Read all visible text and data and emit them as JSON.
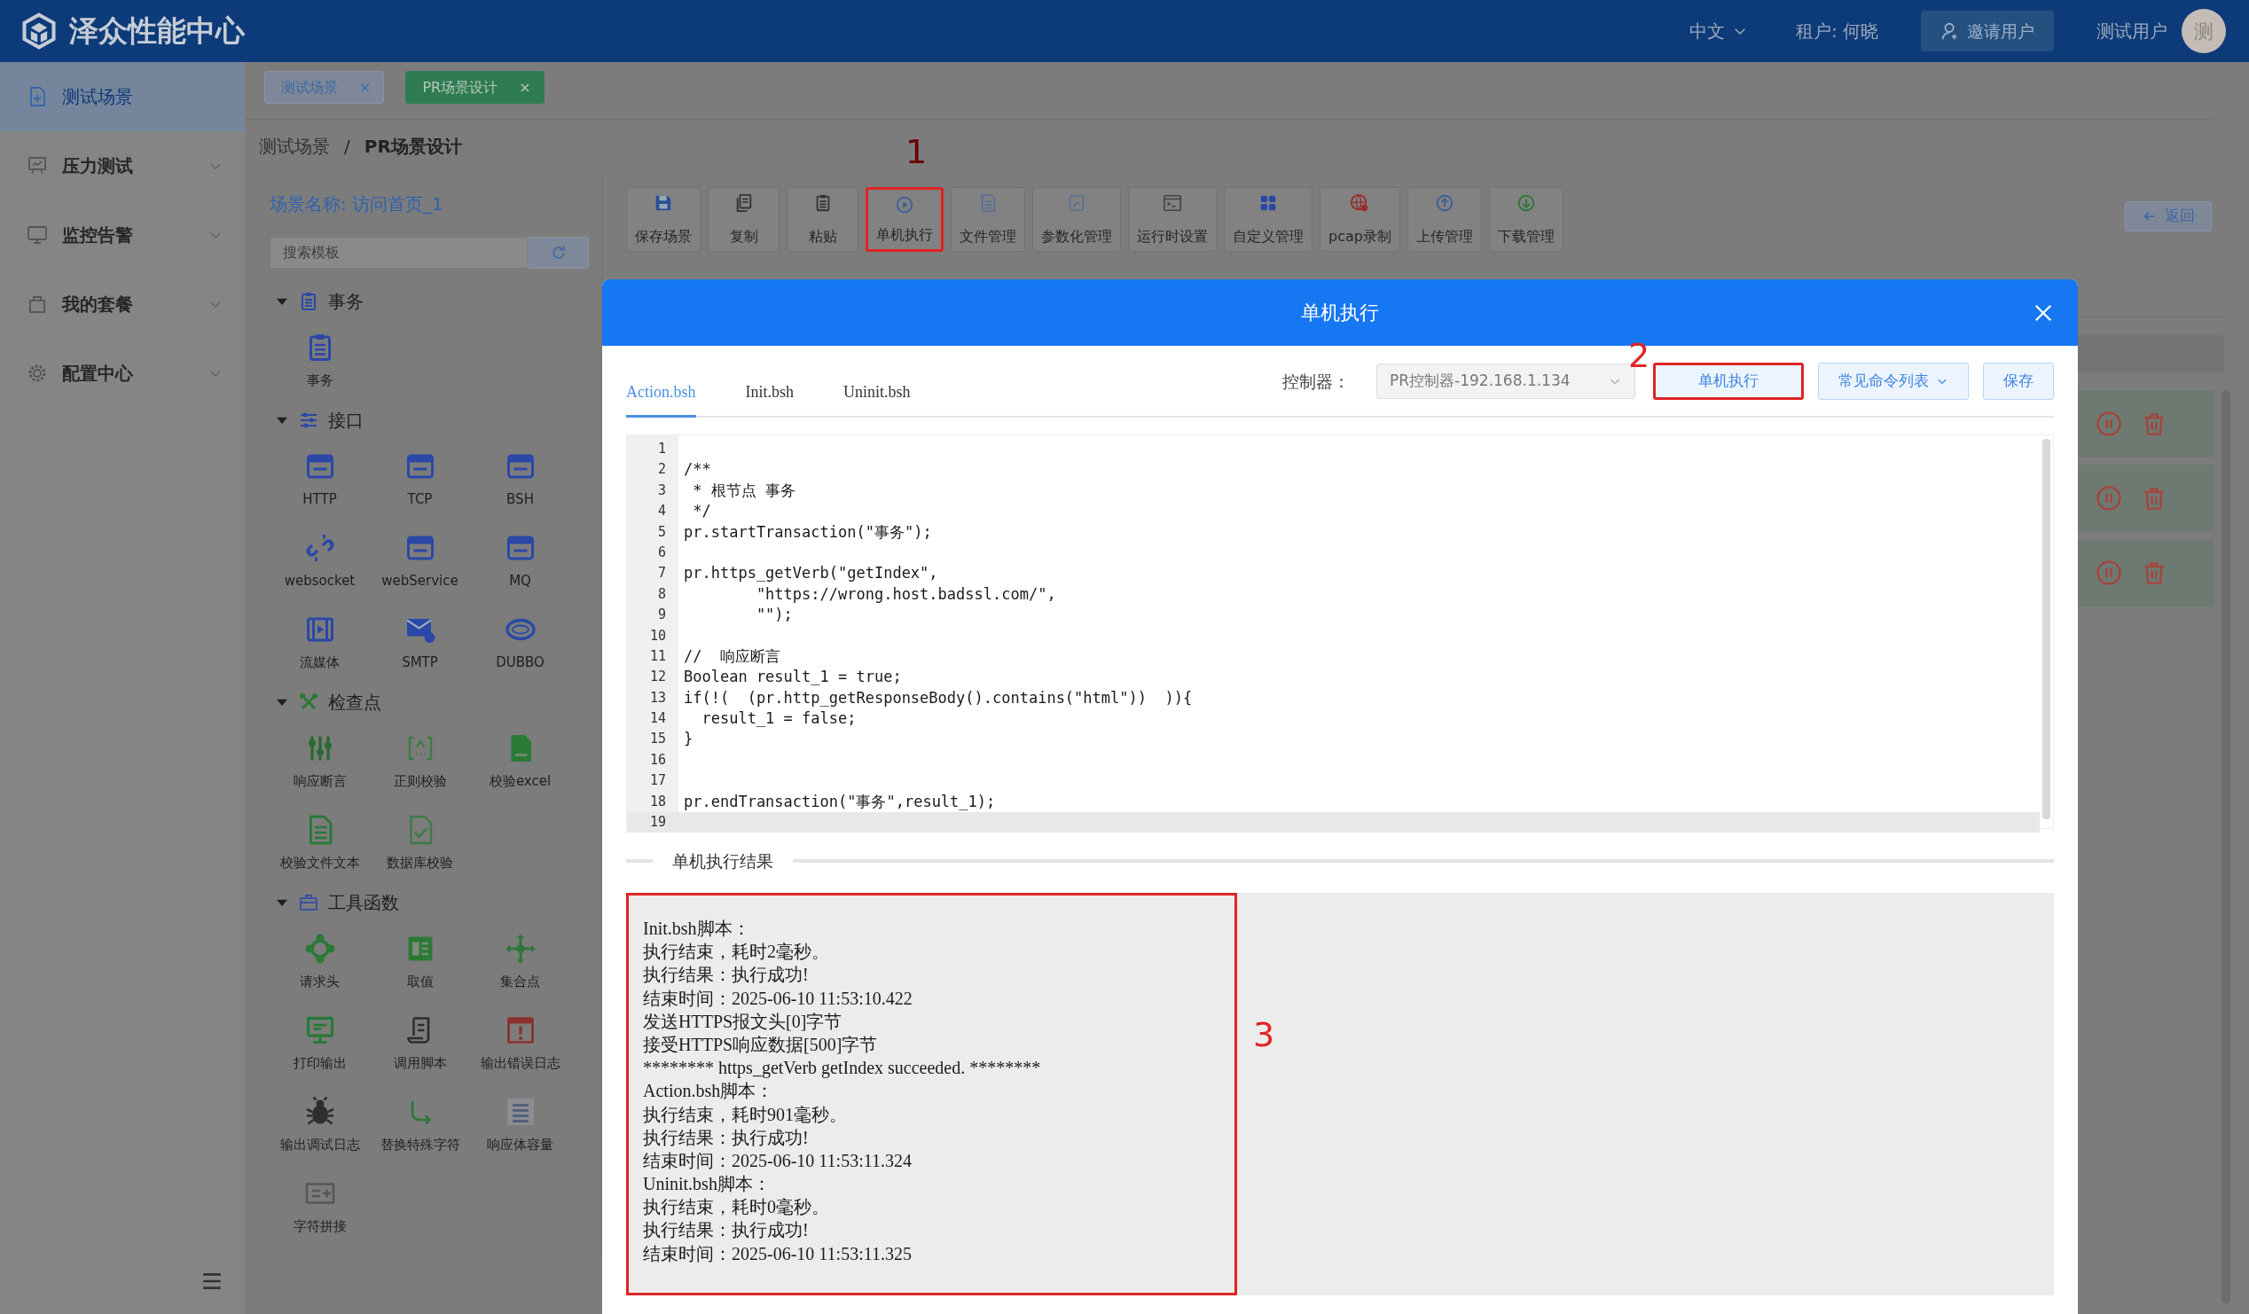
{
  "header": {
    "logo_text": "泽众性能中心",
    "language": "中文",
    "tenant": "租户: 何晓",
    "invite_button": "邀请用户",
    "username": "测试用户",
    "avatar": "测"
  },
  "sidebar": {
    "items": [
      {
        "label": "测试场景",
        "selected": true,
        "expandable": false
      },
      {
        "label": "压力测试",
        "selected": false,
        "expandable": true
      },
      {
        "label": "监控告警",
        "selected": false,
        "expandable": true
      },
      {
        "label": "我的套餐",
        "selected": false,
        "expandable": true
      },
      {
        "label": "配置中心",
        "selected": false,
        "expandable": true
      }
    ]
  },
  "page_tabs": [
    {
      "label": "测试场景",
      "close": "×",
      "selected": false
    },
    {
      "label": "PR场景设计",
      "close": "×",
      "selected": true
    }
  ],
  "breadcrumb": {
    "items": [
      "测试场景",
      "PR场景设计"
    ],
    "separator": "/"
  },
  "palette": {
    "scene_name": "场景名称: 访问首页_1",
    "search_placeholder": "搜索模板",
    "sections": [
      {
        "title": "事务",
        "expanded": true,
        "items": [
          "事务"
        ]
      },
      {
        "title": "接口",
        "expanded": true,
        "items": [
          "HTTP",
          "TCP",
          "BSH",
          "websocket",
          "webService",
          "MQ",
          "流媒体",
          "SMTP",
          "DUBBO"
        ]
      },
      {
        "title": "检查点",
        "expanded": true,
        "items": [
          "响应断言",
          "正则校验",
          "校验excel",
          "校验文件文本",
          "数据库校验"
        ]
      },
      {
        "title": "工具函数",
        "expanded": true,
        "items": [
          "请求头",
          "取值",
          "集合点",
          "打印输出",
          "调用脚本",
          "输出错误日志",
          "输出调试日志",
          "替换特殊字符",
          "响应体容量",
          "字符拼接"
        ]
      }
    ]
  },
  "toolbar": [
    {
      "label": "保存场景",
      "highlighted": false
    },
    {
      "label": "复制",
      "highlighted": false
    },
    {
      "label": "粘贴",
      "highlighted": false
    },
    {
      "label": "单机执行",
      "highlighted": true
    },
    {
      "label": "文件管理",
      "highlighted": false
    },
    {
      "label": "参数化管理",
      "highlighted": false
    },
    {
      "label": "运行时设置",
      "highlighted": false
    },
    {
      "label": "自定义管理",
      "highlighted": false
    },
    {
      "label": "pcap录制",
      "highlighted": false
    },
    {
      "label": "上传管理",
      "highlighted": false
    },
    {
      "label": "下载管理",
      "highlighted": false
    }
  ],
  "back_button": "返回",
  "modal": {
    "title": "单机执行",
    "tabs": [
      {
        "label": "Action.bsh",
        "selected": true
      },
      {
        "label": "Init.bsh",
        "selected": false
      },
      {
        "label": "Uninit.bsh",
        "selected": false
      }
    ],
    "controller_label": "控制器：",
    "controller_value": "PR控制器-192.168.1.134",
    "buttons": [
      {
        "label": "单机执行",
        "kind": "run",
        "highlighted": true
      },
      {
        "label": "常见命令列表",
        "kind": "dropdown",
        "highlighted": false
      },
      {
        "label": "保存",
        "kind": "save",
        "highlighted": false
      }
    ],
    "code_lines": [
      {
        "number": "1",
        "current": false
      },
      {
        "number": "2",
        "text": "/**",
        "current": false
      },
      {
        "number": "3",
        "text": " * 根节点 事务",
        "current": false
      },
      {
        "number": "4",
        "text": " */",
        "current": false
      },
      {
        "number": "5",
        "text": "pr.startTransaction(\"事务\");",
        "current": false
      },
      {
        "number": "6",
        "current": false
      },
      {
        "number": "7",
        "text": "pr.https_getVerb(\"getIndex\",",
        "current": false
      },
      {
        "number": "8",
        "text": "        \"https://wrong.host.badssl.com/\",",
        "current": false
      },
      {
        "number": "9",
        "text": "        \"\");",
        "current": false
      },
      {
        "number": "10",
        "current": false
      },
      {
        "number": "11",
        "text": "//  响应断言",
        "current": false
      },
      {
        "number": "12",
        "text": "Boolean result_1 = true;",
        "current": false
      },
      {
        "number": "13",
        "text": "if(!(  (pr.http_getResponseBody().contains(\"html\"))  )){",
        "current": false
      },
      {
        "number": "14",
        "text": "  result_1 = false;",
        "current": false
      },
      {
        "number": "15",
        "text": "}",
        "current": false
      },
      {
        "number": "16",
        "current": false
      },
      {
        "number": "17",
        "current": false
      },
      {
        "number": "18",
        "text": "pr.endTransaction(\"事务\",result_1);",
        "current": false
      },
      {
        "number": "19",
        "current": true
      }
    ],
    "result_title": "单机执行结果",
    "result_highlighted": true,
    "result_lines": [
      "Init.bsh脚本：",
      "执行结束，耗时2毫秒。",
      "执行结果：执行成功!",
      "结束时间：2025-06-10 11:53:10.422",
      "发送HTTPS报文头[0]字节",
      "接受HTTPS响应数据[500]字节",
      "******** https_getVerb getIndex succeeded. ********",
      "Action.bsh脚本：",
      "执行结束，耗时901毫秒。",
      "执行结果：执行成功!",
      "结束时间：2025-06-10 11:53:11.324",
      "Uninit.bsh脚本：",
      "执行结束，耗时0毫秒。",
      "执行结果：执行成功!",
      "结束时间：2025-06-10 11:53:11.325"
    ]
  },
  "annotations": [
    {
      "label": "1"
    },
    {
      "label": "2"
    },
    {
      "label": "3"
    }
  ]
}
